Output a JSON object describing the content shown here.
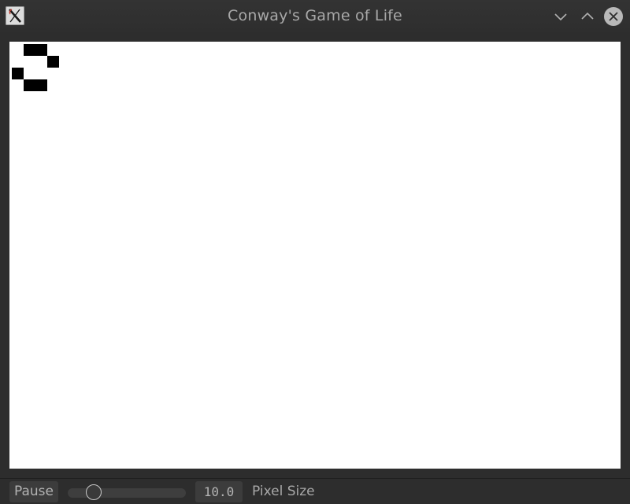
{
  "window": {
    "title": "Conway's Game of Life",
    "icons": {
      "app": "x-logo-icon",
      "minimize": "chevron-down-icon",
      "maximize": "chevron-up-icon",
      "close": "close-icon"
    }
  },
  "toolbar": {
    "pause_label": "Pause",
    "pixel_size_value": "10.0",
    "pixel_size_label": "Pixel Size",
    "slider_level": 0.23
  },
  "colors": {
    "canvas_background": "#ffffff",
    "live_cell": "#000000",
    "chrome_background": "#2d2d2d"
  }
}
